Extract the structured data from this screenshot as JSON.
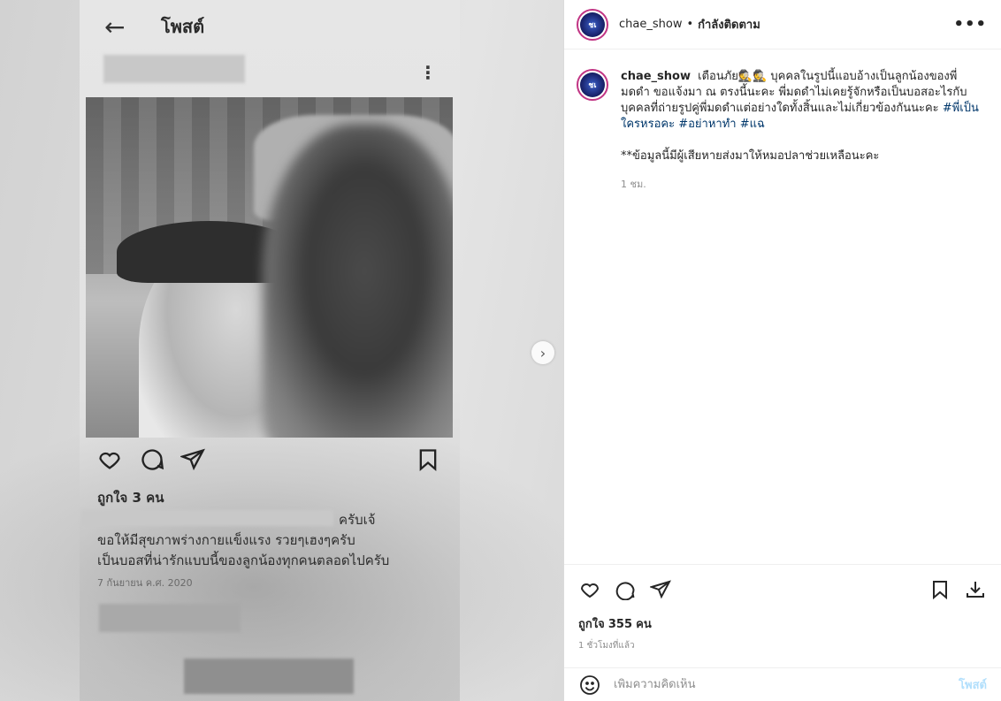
{
  "photo": {
    "screen_title": "โพสต์",
    "back_icon": "arrow-left-icon",
    "more_icon": "more-vertical-icon",
    "likes": "ถูกใจ 3 คน",
    "caption_lines": [
      "ครับเจ้",
      "ขอให้มีสุขภาพร่างกายแข็งแรง รวยๆเฮงๆครับ",
      "เป็นบอสที่น่ารักแบบนี้ของลูกน้องทุกคนตลอดไปครับ"
    ],
    "date": "7 กันยายน ค.ศ. 2020",
    "next_icon": "chevron-right-icon"
  },
  "header": {
    "username": "chae_show",
    "separator": "•",
    "follow_status": "กำลังติดตาม",
    "avatar_text": "ชเ",
    "more_icon": "more-horizontal-icon"
  },
  "caption": {
    "username": "chae_show",
    "text": "เตือนภัย🕵🕵 บุคคลในรูปนี้แอบอ้างเป็นลูกน้องของพี่มดดำ ขอแจ้งมา ณ ตรงนี้นะคะ พี่มดดำไม่เคยรู้จักหรือเป็นบอสอะไรกับบุคคลที่ถ่ายรูปคู่พี่มดดำแต่อย่างใดทั้งสิ้นและไม่เกี่ยวข้องกันนะคะ",
    "hashtags": [
      "#พี่เป็นใครหรอคะ",
      "#อย่าหาทำ",
      "#แฉ"
    ],
    "note": "**ข้อมูลนี้มีผู้เสียหายส่งมาให้หมอปลาช่วยเหลือนะคะ",
    "time": "1 ชม."
  },
  "actions": {
    "like_icon": "heart-icon",
    "comment_icon": "comment-icon",
    "share_icon": "send-icon",
    "save_icon": "bookmark-icon",
    "download_icon": "download-icon",
    "likes_label": "ถูกใจ",
    "likes_count": "355",
    "likes_unit": "คน",
    "time": "1 ชั่วโมงที่แล้ว"
  },
  "comment_box": {
    "emoji_icon": "emoji-icon",
    "placeholder": "เพิ่มความคิดเห็น",
    "post_label": "โพสต์"
  }
}
